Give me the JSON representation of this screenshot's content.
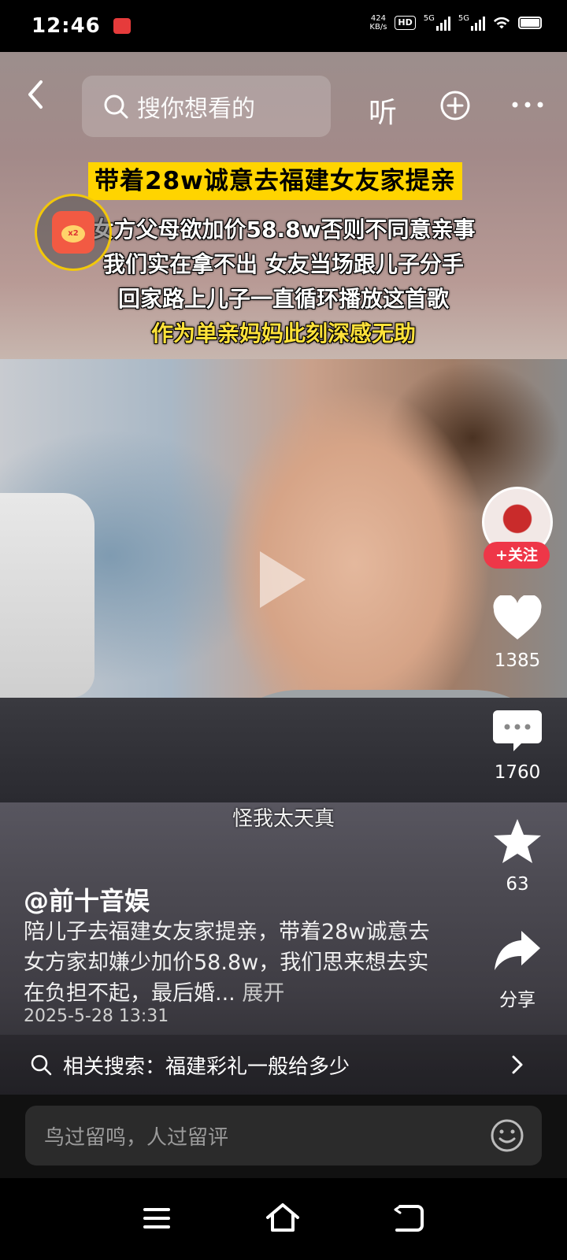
{
  "status_bar": {
    "time": "12:46",
    "net_speed_value": "424",
    "net_speed_unit": "KB/s",
    "hd_badge": "HD",
    "sim1": "5G",
    "sim2": "5G"
  },
  "top_nav": {
    "search_placeholder": "搜你想看的",
    "listen_label": "听"
  },
  "overlay": {
    "headline": "带着28w诚意去福建女友家提亲",
    "lines": [
      "女方父母欲加价58.8w否则不同意亲事",
      "我们实在拿不出 女友当场跟儿子分手",
      "回家路上儿子一直循环播放这首歌"
    ],
    "highlight_line": "作为单亲妈妈此刻深感无助",
    "redpack_badge": "x2"
  },
  "video": {
    "subtitle": "怪我太天真"
  },
  "right_rail": {
    "follow_label": "+关注",
    "likes": "1385",
    "comments": "1760",
    "favorites": "63",
    "share_label": "分享"
  },
  "post": {
    "author": "@前十音娱",
    "description": "陪儿子去福建女友家提亲，带着28w诚意去女方家却嫌少加价58.8w，我们思来想去实在负担不起，最后婚...",
    "expand_label": "展开",
    "date": "2025-5-28 13:31"
  },
  "related_search": {
    "label": "相关搜索：福建彩礼一般给多少"
  },
  "playback": {
    "progress_fraction": 0.185
  },
  "comment": {
    "placeholder": "鸟过留鸣，人过留评"
  },
  "icons": {
    "back": "back-arrow-icon",
    "search": "search-icon",
    "add": "plus-circle-icon",
    "more": "more-dots-icon",
    "play": "play-icon",
    "like": "heart-icon",
    "comment": "comment-bubble-icon",
    "favorite": "star-icon",
    "share": "share-arrow-icon",
    "emoji": "smiley-icon",
    "menu": "menu-icon",
    "home": "home-icon",
    "back_nav": "return-icon"
  },
  "colors": {
    "headline_bg": "#ffd400",
    "follow_bg": "#ee3748",
    "highlight_text": "#ffe23a"
  }
}
